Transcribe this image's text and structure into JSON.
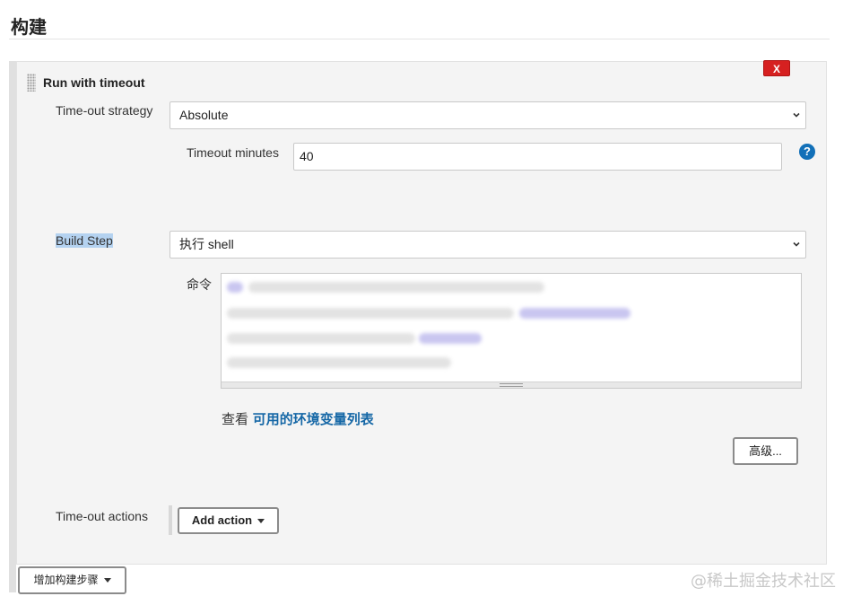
{
  "section": {
    "title": "构建"
  },
  "step": {
    "title": "Run with timeout",
    "delete_label": "X"
  },
  "timeout": {
    "strategy_label": "Time-out strategy",
    "strategy_value": "Absolute",
    "minutes_label": "Timeout minutes",
    "minutes_value": "40",
    "help_label": "?"
  },
  "build_step": {
    "label": "Build Step",
    "value": "执行 shell",
    "command_label": "命令"
  },
  "env": {
    "prefix": "查看",
    "link": "可用的环境变量列表"
  },
  "advanced_button": "高级...",
  "timeout_actions": {
    "label": "Time-out actions",
    "add_button": "Add action"
  },
  "add_build_step_button": "增加构建步骤",
  "watermark": "@稀土掘金技术社区",
  "colors": {
    "delete": "#d62020",
    "link": "#1567a6",
    "help": "#1270b8",
    "selection_highlight": "#b4d2f0"
  },
  "icons": [
    "drag-handle-icon",
    "close-icon",
    "chevron-down-icon",
    "help-icon",
    "caret-down-icon"
  ]
}
